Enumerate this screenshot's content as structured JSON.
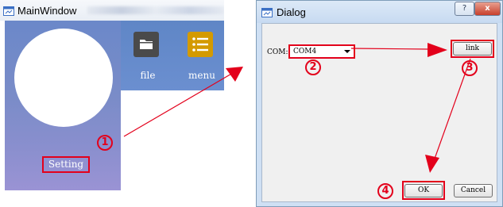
{
  "main_window": {
    "title": "MainWindow",
    "toolbar": {
      "file_label": "file",
      "menu_label": "menu"
    },
    "setting_label": "Setting"
  },
  "dialog": {
    "title": "Dialog",
    "help_button": "?",
    "close_button": "x",
    "com_label": "COM:",
    "com_value": "COM4",
    "link_button": "link",
    "ok_button": "OK",
    "cancel_button": "Cancel"
  },
  "annotations": {
    "step1": "1",
    "step2": "2",
    "step3": "3",
    "step4": "4"
  },
  "colors": {
    "annotation_red": "#e3001b",
    "panel_blue": "#6b88c9",
    "toolbar_blue": "#5f86c6",
    "dialog_frame": "#cfe0f4"
  },
  "icons": {
    "file": "folder-icon",
    "menu": "list-menu-icon",
    "window": "window-app-icon"
  }
}
